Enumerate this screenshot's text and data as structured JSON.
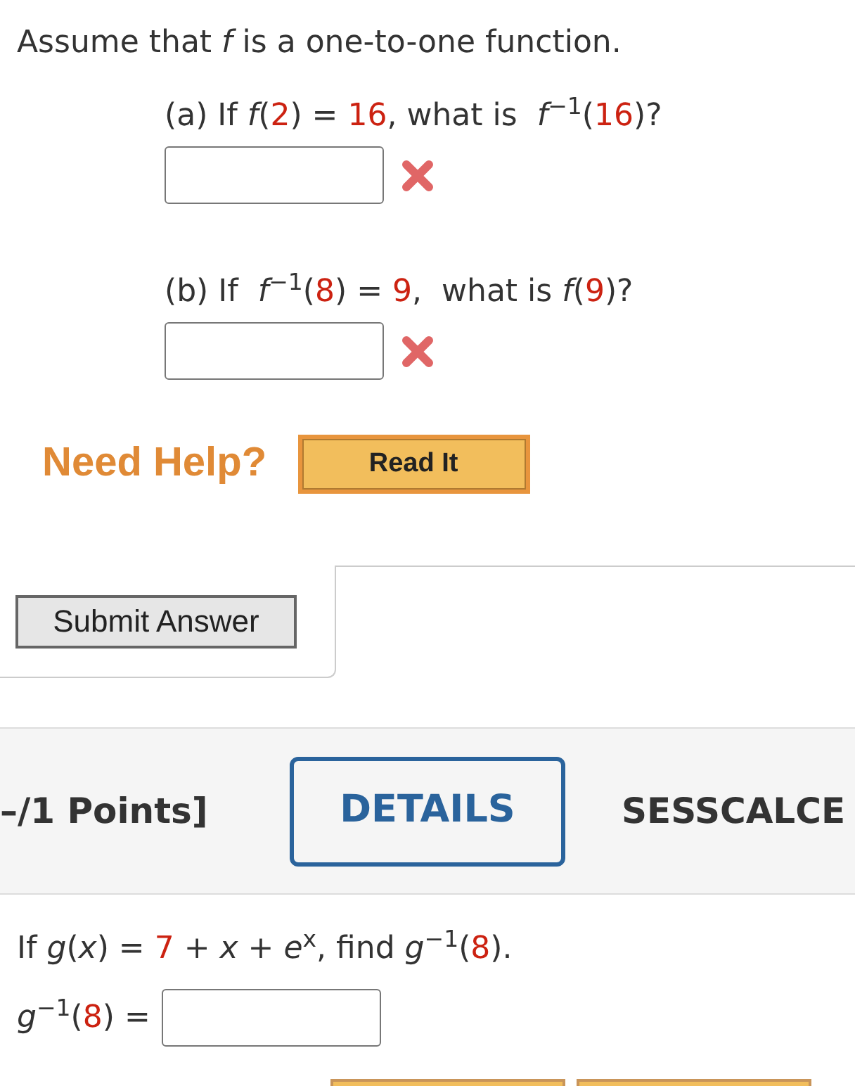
{
  "intro": [
    {
      "kind": "text",
      "text": "Assume that *f* is a one-to-one function."
    }
  ],
  "parts": [
    {
      "question": [
        {
          "kind": "text",
          "text": "(a) If *f*("
        },
        {
          "kind": "given",
          "text": "2"
        },
        {
          "kind": "text",
          "text": ") = "
        },
        {
          "kind": "given",
          "text": "16"
        },
        {
          "kind": "text",
          "text": ", what is  *f*$^{−1}$("
        },
        {
          "kind": "given",
          "text": "16"
        },
        {
          "kind": "text",
          "text": ")?"
        }
      ],
      "answer": {
        "correct": false
      }
    },
    {
      "question": [
        {
          "kind": "text",
          "text": "(b) If  *f*$^{−1}$("
        },
        {
          "kind": "given",
          "text": "8"
        },
        {
          "kind": "text",
          "text": ") = "
        },
        {
          "kind": "given",
          "text": "9"
        },
        {
          "kind": "text",
          "text": ",  what is *f*("
        },
        {
          "kind": "given",
          "text": "9"
        },
        {
          "kind": "text",
          "text": ")?"
        }
      ],
      "answer": {
        "correct": false
      }
    }
  ],
  "help": {
    "label": "Need Help?",
    "buttons": [
      "Read It"
    ]
  },
  "submit_button": "Submit Answer",
  "next_question": {
    "points": "–/1 Points]",
    "details_button": "DETAILS",
    "code": "SESSCALCE",
    "question": [
      {
        "kind": "text",
        "text": "If *g*(*x*) = "
      },
      {
        "kind": "given",
        "text": "7"
      },
      {
        "kind": "text",
        "text": " + *x* + *e*$^{x}$, find *g*$^{−1}$("
      },
      {
        "kind": "given",
        "text": "8"
      },
      {
        "kind": "text",
        "text": ")."
      }
    ],
    "answer_label": [
      {
        "kind": "text",
        "text": "*g*$^{−1}$("
      },
      {
        "kind": "given",
        "text": "8"
      },
      {
        "kind": "text",
        "text": ") ="
      }
    ]
  }
}
